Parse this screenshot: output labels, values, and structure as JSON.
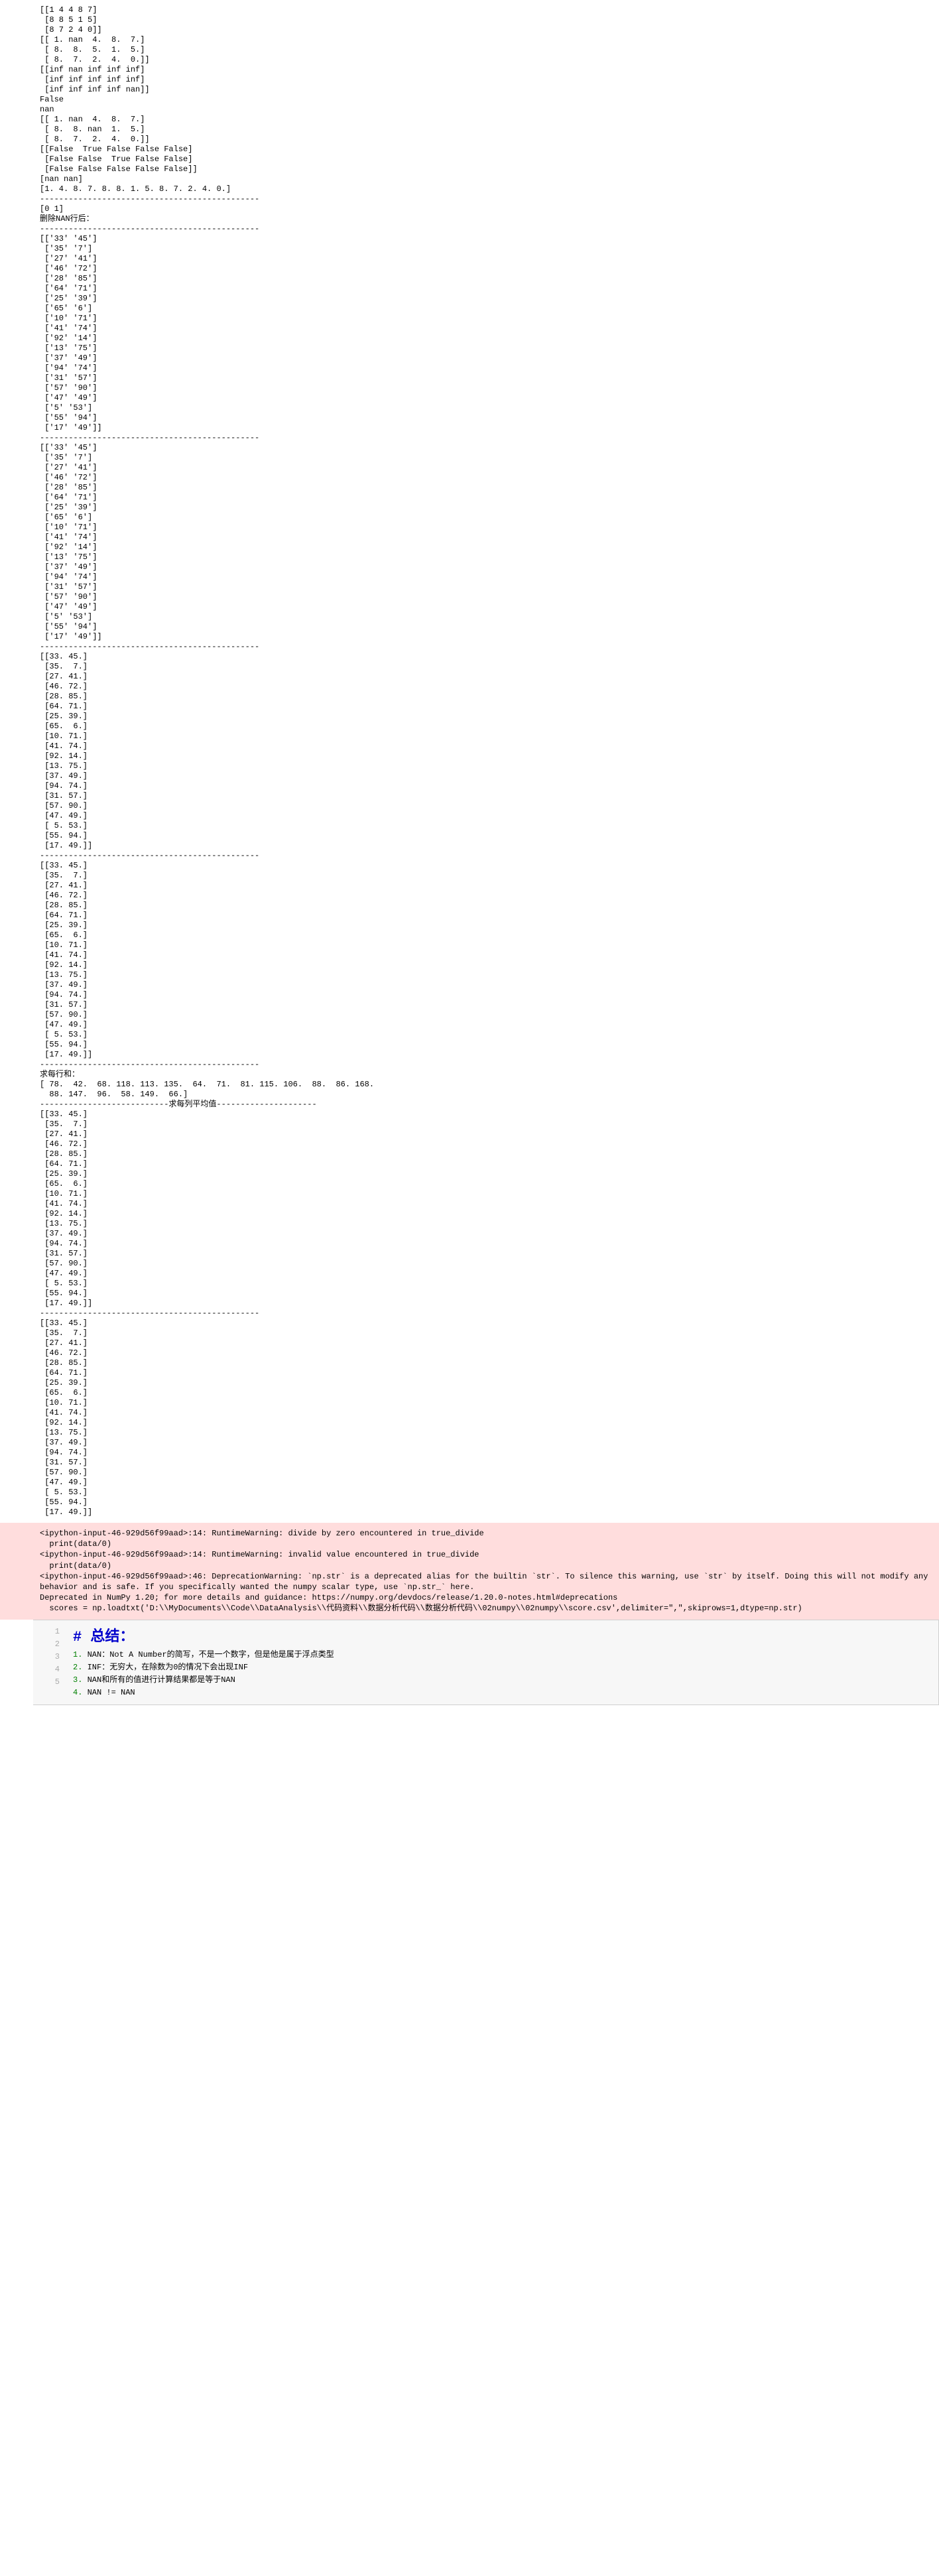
{
  "stdout_block": "[[1 4 4 8 7]\n [8 8 5 1 5]\n [8 7 2 4 0]]\n[[ 1. nan  4.  8.  7.]\n [ 8.  8.  5.  1.  5.]\n [ 8.  7.  2.  4.  0.]]\n[[inf nan inf inf inf]\n [inf inf inf inf inf]\n [inf inf inf inf nan]]\nFalse\nnan\n[[ 1. nan  4.  8.  7.]\n [ 8.  8. nan  1.  5.]\n [ 8.  7.  2.  4.  0.]]\n[[False  True False False False]\n [False False  True False False]\n [False False False False False]]\n[nan nan]\n[1. 4. 8. 7. 8. 8. 1. 5. 8. 7. 2. 4. 0.]\n----------------------------------------------\n[0 1]\n删除NAN行后：\n----------------------------------------------\n[['33' '45']\n ['35' '7']\n ['27' '41']\n ['46' '72']\n ['28' '85']\n ['64' '71']\n ['25' '39']\n ['65' '6']\n ['10' '71']\n ['41' '74']\n ['92' '14']\n ['13' '75']\n ['37' '49']\n ['94' '74']\n ['31' '57']\n ['57' '90']\n ['47' '49']\n ['5' '53']\n ['55' '94']\n ['17' '49']]\n----------------------------------------------\n[['33' '45']\n ['35' '7']\n ['27' '41']\n ['46' '72']\n ['28' '85']\n ['64' '71']\n ['25' '39']\n ['65' '6']\n ['10' '71']\n ['41' '74']\n ['92' '14']\n ['13' '75']\n ['37' '49']\n ['94' '74']\n ['31' '57']\n ['57' '90']\n ['47' '49']\n ['5' '53']\n ['55' '94']\n ['17' '49']]\n----------------------------------------------\n[[33. 45.]\n [35.  7.]\n [27. 41.]\n [46. 72.]\n [28. 85.]\n [64. 71.]\n [25. 39.]\n [65.  6.]\n [10. 71.]\n [41. 74.]\n [92. 14.]\n [13. 75.]\n [37. 49.]\n [94. 74.]\n [31. 57.]\n [57. 90.]\n [47. 49.]\n [ 5. 53.]\n [55. 94.]\n [17. 49.]]\n----------------------------------------------\n[[33. 45.]\n [35.  7.]\n [27. 41.]\n [46. 72.]\n [28. 85.]\n [64. 71.]\n [25. 39.]\n [65.  6.]\n [10. 71.]\n [41. 74.]\n [92. 14.]\n [13. 75.]\n [37. 49.]\n [94. 74.]\n [31. 57.]\n [57. 90.]\n [47. 49.]\n [ 5. 53.]\n [55. 94.]\n [17. 49.]]\n----------------------------------------------\n求每行和：\n[ 78.  42.  68. 118. 113. 135.  64.  71.  81. 115. 106.  88.  86. 168.\n  88. 147.  96.  58. 149.  66.]\n---------------------------求每列平均值---------------------\n[[33. 45.]\n [35.  7.]\n [27. 41.]\n [46. 72.]\n [28. 85.]\n [64. 71.]\n [25. 39.]\n [65.  6.]\n [10. 71.]\n [41. 74.]\n [92. 14.]\n [13. 75.]\n [37. 49.]\n [94. 74.]\n [31. 57.]\n [57. 90.]\n [47. 49.]\n [ 5. 53.]\n [55. 94.]\n [17. 49.]]\n----------------------------------------------\n[[33. 45.]\n [35.  7.]\n [27. 41.]\n [46. 72.]\n [28. 85.]\n [64. 71.]\n [25. 39.]\n [65.  6.]\n [10. 71.]\n [41. 74.]\n [92. 14.]\n [13. 75.]\n [37. 49.]\n [94. 74.]\n [31. 57.]\n [57. 90.]\n [47. 49.]\n [ 5. 53.]\n [55. 94.]\n [17. 49.]]",
  "stderr_block": "<ipython-input-46-929d56f99aad>:14: RuntimeWarning: divide by zero encountered in true_divide\n  print(data/0)\n<ipython-input-46-929d56f99aad>:14: RuntimeWarning: invalid value encountered in true_divide\n  print(data/0)\n<ipython-input-46-929d56f99aad>:46: DeprecationWarning: `np.str` is a deprecated alias for the builtin `str`. To silence this warning, use `str` by itself. Doing this will not modify any behavior and is safe. If you specifically wanted the numpy scalar type, use `np.str_` here.\nDeprecated in NumPy 1.20; for more details and guidance: https://numpy.org/devdocs/release/1.20.0-notes.html#deprecations\n  scores = np.loadtxt('D:\\\\MyDocuments\\\\Code\\\\DataAnalysis\\\\代码资料\\\\数据分析代码\\\\数据分析代码\\\\02numpy\\\\02numpy\\\\score.csv',delimiter=\",\",skiprows=1,dtype=np.str)",
  "code_cell": {
    "gutter": [
      "1",
      "2",
      "3",
      "4",
      "5"
    ],
    "header": "# 总结：",
    "line2_prefix": "1. ",
    "line2_text": "NAN：Not A Number的简写，不是一个数字，但是他是属于浮点类型",
    "line3_prefix": "2. ",
    "line3_text": "INF：无穷大，在除数为0的情况下会出现INF",
    "line4_prefix": "3. ",
    "line4_text": "NAN和所有的值进行计算结果都是等于NAN",
    "line5_prefix": "4. ",
    "line5_text": "NAN != NAN"
  }
}
